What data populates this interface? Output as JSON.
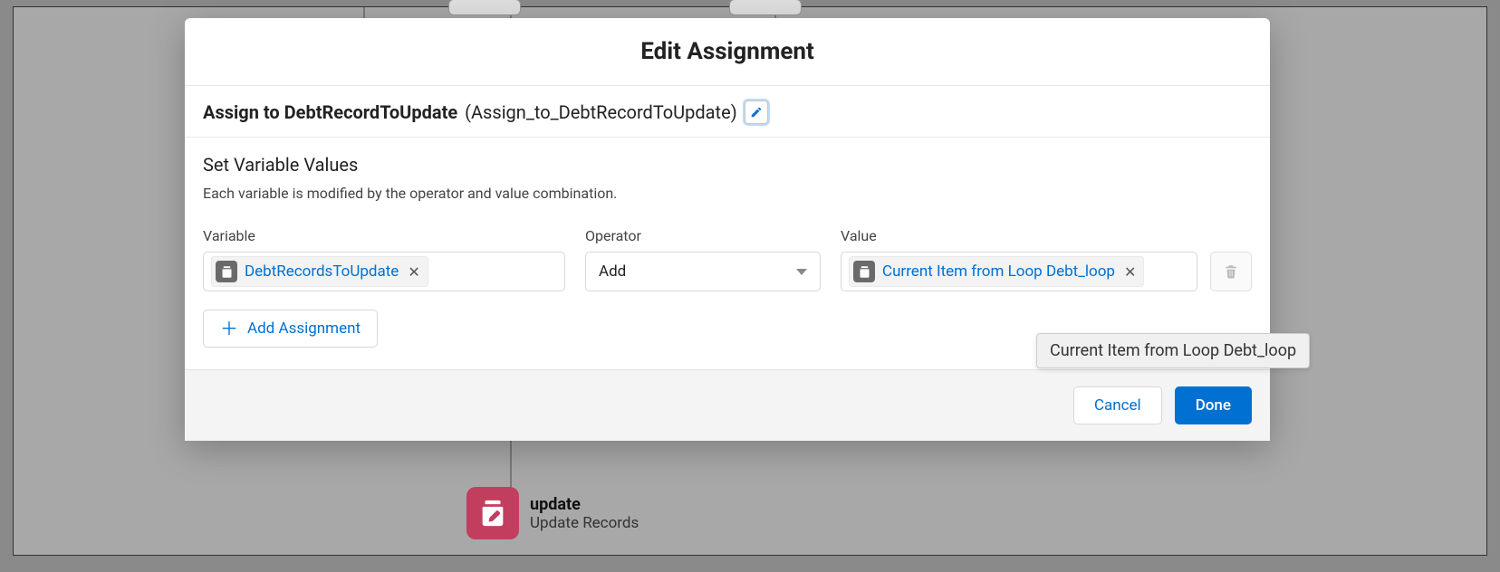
{
  "modal": {
    "title": "Edit Assignment",
    "label": "Assign to DebtRecordToUpdate",
    "api_name": "(Assign_to_DebtRecordToUpdate)"
  },
  "section": {
    "title": "Set Variable Values",
    "description": "Each variable is modified by the operator and value combination."
  },
  "columns": {
    "variable": "Variable",
    "operator": "Operator",
    "value": "Value"
  },
  "row": {
    "variable": "DebtRecordsToUpdate",
    "operator": "Add",
    "value": "Current Item from Loop Debt_loop"
  },
  "buttons": {
    "add_assignment": "Add Assignment",
    "cancel": "Cancel",
    "done": "Done"
  },
  "tooltip": "Current Item from Loop Debt_loop",
  "background": {
    "update_title": "update",
    "update_sub": "Update Records"
  }
}
